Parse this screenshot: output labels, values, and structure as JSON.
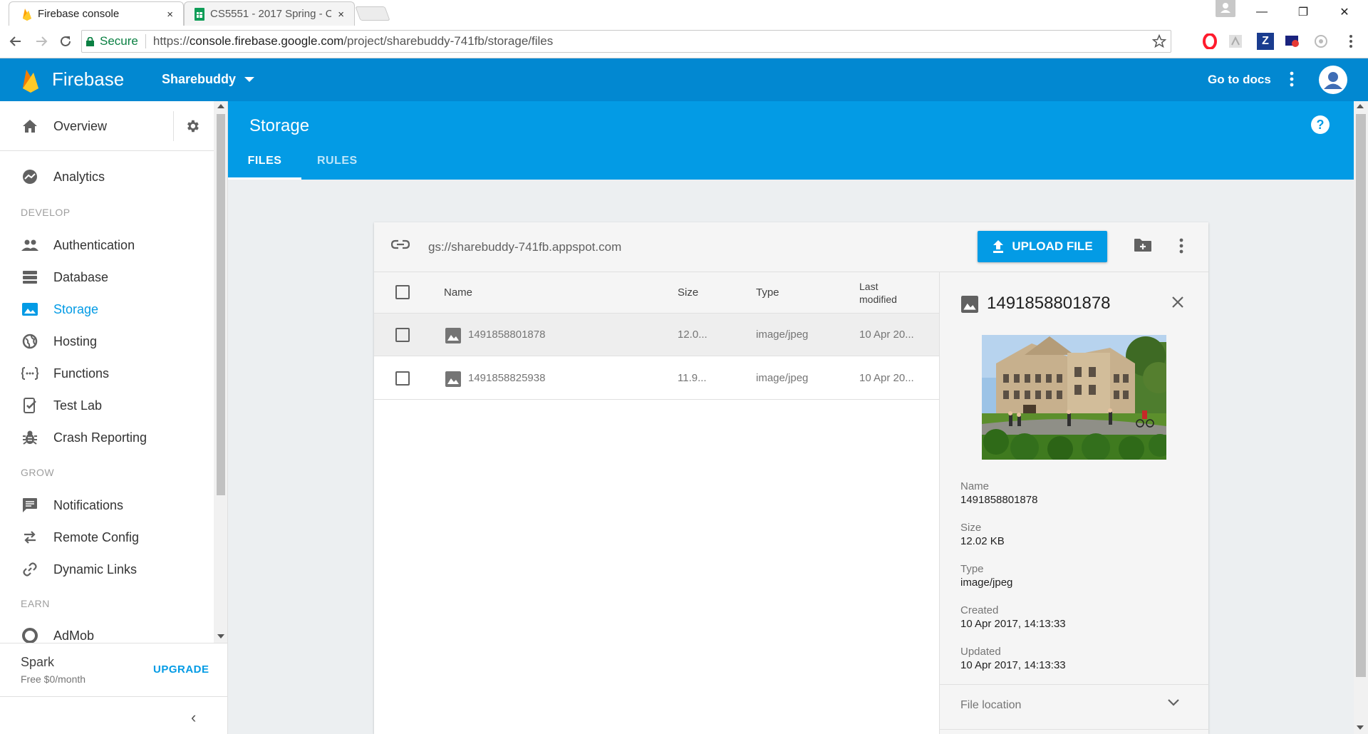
{
  "browser": {
    "tabs": [
      {
        "title": "Firebase console",
        "close": "×"
      },
      {
        "title": "CS5551 - 2017 Spring - C",
        "close": "×"
      }
    ],
    "window_buttons": {
      "minimize": "—",
      "restore": "❐",
      "close": "✕"
    },
    "secure_label": "Secure",
    "url_prefix": "https://",
    "url_domain": "console.firebase.google.com",
    "url_path": "/project/sharebuddy-741fb/storage/files"
  },
  "header": {
    "brand": "Firebase",
    "project": "Sharebuddy",
    "go_to_docs": "Go to docs"
  },
  "sidebar": {
    "overview": "Overview",
    "analytics": "Analytics",
    "sections": {
      "develop": "DEVELOP",
      "grow": "GROW",
      "earn": "EARN"
    },
    "develop_items": [
      "Authentication",
      "Database",
      "Storage",
      "Hosting",
      "Functions",
      "Test Lab",
      "Crash Reporting"
    ],
    "grow_items": [
      "Notifications",
      "Remote Config",
      "Dynamic Links"
    ],
    "earn_items": [
      "AdMob"
    ],
    "plan": {
      "name": "Spark",
      "price": "Free $0/month",
      "upgrade": "UPGRADE"
    },
    "collapse": "‹"
  },
  "page": {
    "title": "Storage",
    "tabs": {
      "files": "FILES",
      "rules": "RULES"
    },
    "help": "?"
  },
  "storage": {
    "bucket": "gs://sharebuddy-741fb.appspot.com",
    "upload_label": "UPLOAD FILE",
    "columns": {
      "name": "Name",
      "size": "Size",
      "type": "Type",
      "modified_1": "Last",
      "modified_2": "modified"
    },
    "files": [
      {
        "name": "1491858801878",
        "size": "12.0...",
        "type": "image/jpeg",
        "modified": "10 Apr 20..."
      },
      {
        "name": "1491858825938",
        "size": "11.9...",
        "type": "image/jpeg",
        "modified": "10 Apr 20..."
      }
    ]
  },
  "detail": {
    "title": "1491858801878",
    "fields": [
      {
        "label": "Name",
        "value": "1491858801878"
      },
      {
        "label": "Size",
        "value": "12.02 KB"
      },
      {
        "label": "Type",
        "value": "image/jpeg"
      },
      {
        "label": "Created",
        "value": "10 Apr 2017, 14:13:33"
      },
      {
        "label": "Updated",
        "value": "10 Apr 2017, 14:13:33"
      }
    ],
    "file_location": "File location"
  },
  "colors": {
    "firebase_blue": "#039be5",
    "header_blue": "#0288d1",
    "brand_yellow": "#ffca28",
    "secure_green": "#0b8043"
  }
}
